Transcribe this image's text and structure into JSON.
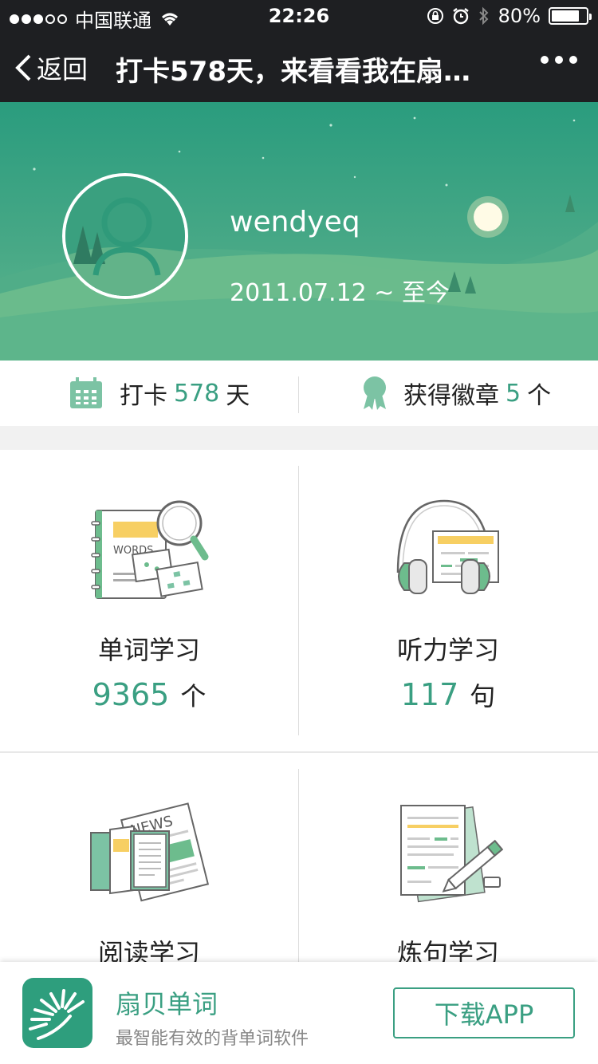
{
  "status_bar": {
    "carrier": "中国联通",
    "time": "22:26",
    "battery": "80%",
    "battery_level": 0.8,
    "icons": [
      "signal-dots-icon",
      "wifi-icon",
      "lock-rotation-icon",
      "alarm-icon",
      "bluetooth-icon",
      "battery-icon"
    ]
  },
  "nav": {
    "back_label": "返回",
    "title": "打卡578天，来看看我在扇…",
    "more_icon": "more-dots-icon"
  },
  "profile": {
    "username": "wendyeq",
    "date_range": "2011.07.12 ~ 至今"
  },
  "stats": {
    "checkin": {
      "prefix": "打卡",
      "value": "578",
      "unit": "天",
      "icon": "calendar-icon"
    },
    "badges": {
      "prefix": "获得徽章",
      "value": "5",
      "unit": "个",
      "icon": "badge-icon"
    }
  },
  "modules": [
    {
      "title": "单词学习",
      "count": "9365",
      "unit": "个",
      "icon": "words-book-icon",
      "illus_text": "WORDS"
    },
    {
      "title": "听力学习",
      "count": "117",
      "unit": "句",
      "icon": "headphones-icon"
    },
    {
      "title": "阅读学习",
      "icon": "news-reading-icon",
      "illus_text": "NEWS"
    },
    {
      "title": "炼句学习",
      "icon": "sentence-writing-icon"
    }
  ],
  "banner": {
    "app_name": "扇贝单词",
    "app_desc": "最智能有效的背单词软件",
    "download_label": "下载APP"
  },
  "colors": {
    "accent": "#3a9f82",
    "nav_bg": "#1e1f22",
    "hero_top": "#2a9c7e",
    "hero_bottom": "#5fb88e"
  }
}
